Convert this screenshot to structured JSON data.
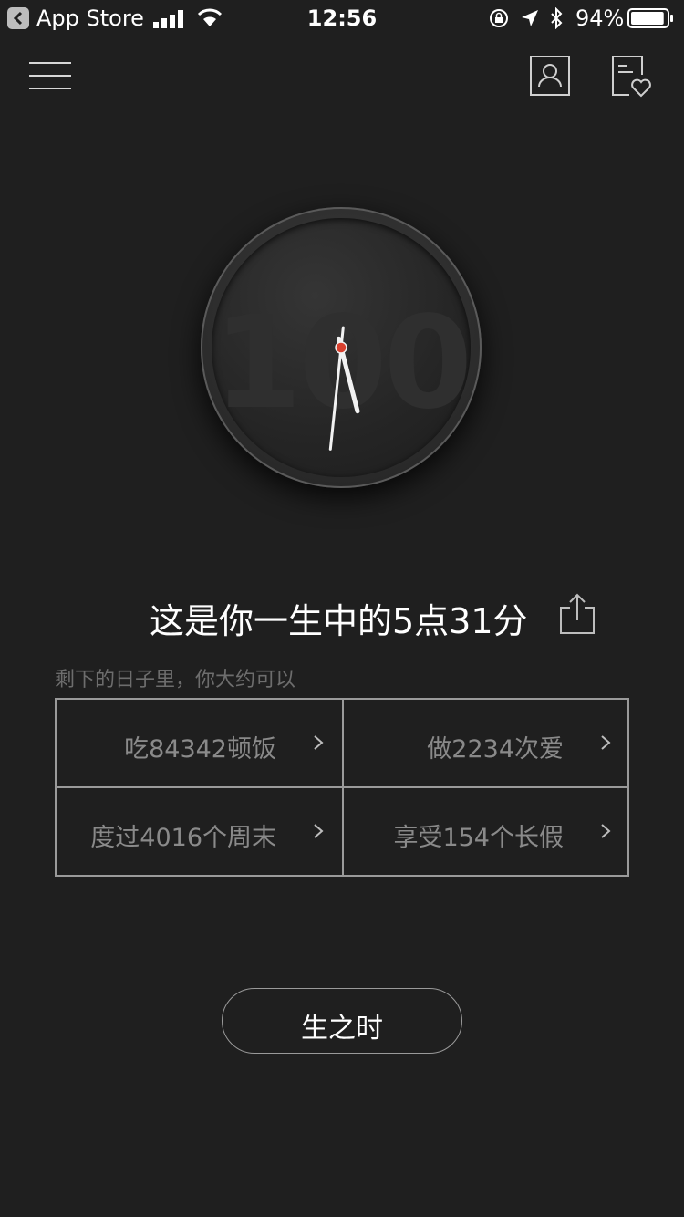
{
  "status_bar": {
    "back_app": "App Store",
    "time": "12:56",
    "battery_percent": "94%",
    "battery_level": 0.94,
    "icons": [
      "back-arrow-icon",
      "signal-icon",
      "wifi-icon",
      "orientation-lock-icon",
      "location-icon",
      "bluetooth-icon",
      "battery-icon"
    ]
  },
  "nav": {
    "icons": [
      "hamburger-menu-icon",
      "user-profile-icon",
      "favorites-list-icon"
    ]
  },
  "clock": {
    "face_number": "100",
    "hour": 5,
    "minute": 31,
    "center_color": "#d9402e"
  },
  "main": {
    "caption": "这是你一生中的5点31分",
    "share_icon": "share-icon",
    "subtitle": "剩下的日子里，你大约可以",
    "cells": [
      {
        "label": "吃84342顿饭"
      },
      {
        "label": "做2234次爱"
      },
      {
        "label": "度过4016个周末"
      },
      {
        "label": "享受154个长假"
      }
    ]
  },
  "bottom_button": {
    "label": "生之时"
  },
  "colors": {
    "background": "#1f1f1f",
    "text_primary": "#ffffff",
    "text_muted": "#8a8a8a",
    "border": "#9a9a9a"
  }
}
